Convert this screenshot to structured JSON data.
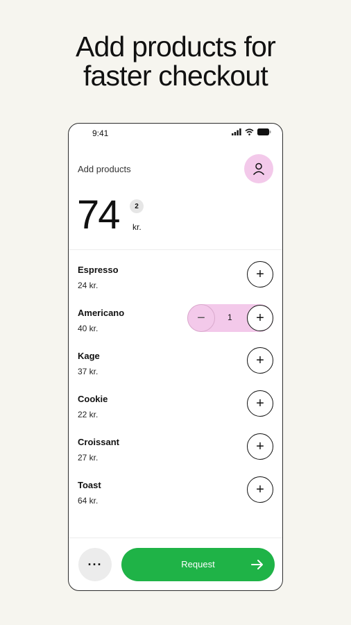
{
  "headline": {
    "line1": "Add products for",
    "line2": "faster checkout"
  },
  "status_bar": {
    "time": "9:41"
  },
  "header": {
    "title": "Add products"
  },
  "summary": {
    "total": "74",
    "count": "2",
    "currency": "kr."
  },
  "products": [
    {
      "name": "Espresso",
      "price": "24 kr."
    },
    {
      "name": "Americano",
      "price": "40 kr.",
      "quantity": "1"
    },
    {
      "name": "Kage",
      "price": "37 kr."
    },
    {
      "name": "Cookie",
      "price": "22 kr."
    },
    {
      "name": "Croissant",
      "price": "27 kr."
    },
    {
      "name": "Toast",
      "price": "64 kr."
    }
  ],
  "footer": {
    "more_label": "···",
    "request_label": "Request"
  },
  "colors": {
    "accent_pink": "#f3c9ea",
    "request_green": "#1fb347",
    "background": "#f6f5ef"
  },
  "icons": [
    "signal-icon",
    "wifi-icon",
    "battery-icon",
    "user-icon",
    "plus-icon",
    "minus-icon",
    "arrow-right-icon"
  ]
}
